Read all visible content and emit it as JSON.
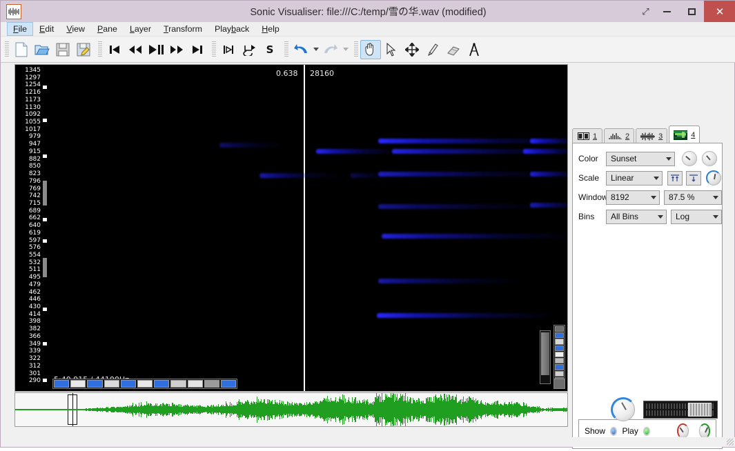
{
  "window": {
    "title": "Sonic Visualiser: file:///C:/temp/雪の华.wav (modified)",
    "app_icon": "waveform-icon",
    "buttons": {
      "restore": "⤢",
      "minimize": "—",
      "maximize": "▢",
      "close": "✕"
    }
  },
  "menubar": {
    "items": [
      {
        "label": "File",
        "mnemonic": "F",
        "active": true
      },
      {
        "label": "Edit",
        "mnemonic": "E",
        "active": false
      },
      {
        "label": "View",
        "mnemonic": "V",
        "active": false
      },
      {
        "label": "Pane",
        "mnemonic": "P",
        "active": false
      },
      {
        "label": "Layer",
        "mnemonic": "L",
        "active": false
      },
      {
        "label": "Transform",
        "mnemonic": "T",
        "active": false
      },
      {
        "label": "Playback",
        "mnemonic": "b",
        "active": false
      },
      {
        "label": "Help",
        "mnemonic": "H",
        "active": false
      }
    ]
  },
  "toolbar": {
    "groups": [
      {
        "buttons": [
          "new-file-icon",
          "open-file-icon",
          "save-icon",
          "save-as-icon"
        ]
      },
      {
        "buttons": [
          "rewind-to-start-icon",
          "rewind-icon",
          "play-pause-icon",
          "fast-forward-icon",
          "forward-to-end-icon"
        ]
      },
      {
        "buttons": [
          "jump-to-boundary-icon",
          "loop-playback-icon",
          "solo-current-pane-icon"
        ]
      },
      {
        "buttons": [
          "undo-icon",
          "redo-icon"
        ]
      },
      {
        "buttons": [
          "navigate-tool-icon",
          "select-tool-icon",
          "edit-move-tool-icon",
          "draw-tool-icon",
          "erase-tool-icon",
          "measure-tool-icon"
        ]
      }
    ],
    "selected_tool": "navigate-tool-icon",
    "redo_enabled": false
  },
  "pane": {
    "time_position_label": "0.638",
    "sample_position_label": "28160",
    "status_label": "5:40.915 / 44100Hz",
    "frequency_axis": [
      "1345",
      "1297",
      "1254",
      "1216",
      "1173",
      "1130",
      "1092",
      "1055",
      "1017",
      "979",
      "947",
      "915",
      "882",
      "850",
      "823",
      "796",
      "769",
      "742",
      "715",
      "689",
      "662",
      "640",
      "619",
      "597",
      "576",
      "554",
      "532",
      "511",
      "495",
      "479",
      "462",
      "446",
      "430",
      "414",
      "398",
      "382",
      "366",
      "349",
      "339",
      "322",
      "312",
      "301",
      "290"
    ]
  },
  "properties": {
    "tabs": [
      {
        "number": "1",
        "icon": "panes-layout-icon",
        "active": false
      },
      {
        "number": "2",
        "icon": "waveform-bars-icon",
        "active": false
      },
      {
        "number": "3",
        "icon": "waveform-line-icon",
        "active": false
      },
      {
        "number": "4",
        "icon": "spectrogram-thumbnail-icon",
        "active": true
      }
    ],
    "rows": [
      {
        "label": "Color",
        "value": "Sunset",
        "second": null
      },
      {
        "label": "Scale",
        "value": "Linear",
        "second": null
      },
      {
        "label": "Window",
        "value": "8192",
        "second": "87.5 %"
      },
      {
        "label": "Bins",
        "value": "All Bins",
        "second": "Log"
      }
    ],
    "gain_knob": "gain-knob",
    "threshold_knob": "threshold-knob",
    "normalize_columns_button": "normalize-columns-icon",
    "normalize_visible_button": "normalize-visible-area-icon",
    "colour_rotation_knob": "colour-rotation-knob",
    "footer": {
      "show_label": "Show",
      "play_label": "Play",
      "show_state": "on",
      "play_state": "on",
      "pan_knob": "pan-knob",
      "gain_knob": "playback-gain-knob"
    }
  },
  "overview": {
    "selection_name": "viewport-selector",
    "waveform_color": "#1f9e1f"
  },
  "bottom_controls": {
    "zoom_knob": "zoom-knob",
    "slider": "horizontal-zoom-slider"
  },
  "colors": {
    "titlebar": "#d8cbd9",
    "close_button": "#c0504d",
    "accent_blue": "#2f86e0",
    "spectro_streak": "#1414ff",
    "waveform_green": "#1f9e1f"
  }
}
